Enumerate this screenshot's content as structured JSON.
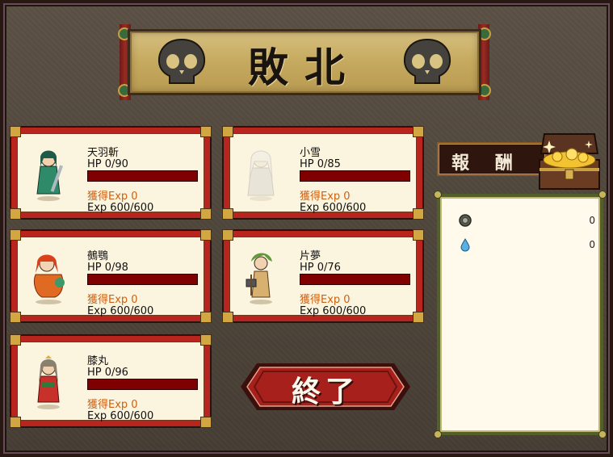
{
  "title": "敗北",
  "units": [
    {
      "name": "天羽斬",
      "hp": "HP 0/90",
      "hp_fraction": 0,
      "exp_gain": "獲得Exp 0",
      "exp": "Exp 600/600",
      "portrait": "green-armored-swordsman",
      "faded": false
    },
    {
      "name": "小雪",
      "hp": "HP 0/85",
      "hp_fraction": 0,
      "exp_gain": "獲得Exp 0",
      "exp": "Exp 600/600",
      "portrait": "white-haired-girl",
      "faded": true
    },
    {
      "name": "鵺鶚",
      "hp": "HP 0/98",
      "hp_fraction": 0,
      "exp_gain": "獲得Exp 0",
      "exp": "Exp 600/600",
      "portrait": "red-feathered-girl",
      "faded": false
    },
    {
      "name": "片夢",
      "hp": "HP 0/76",
      "hp_fraction": 0,
      "exp_gain": "獲得Exp 0",
      "exp": "Exp 600/600",
      "portrait": "green-haired-axe-girl",
      "faded": false
    },
    {
      "name": "膝丸",
      "hp": "HP 0/96",
      "hp_fraction": 0,
      "exp_gain": "獲得Exp 0",
      "exp": "Exp 600/600",
      "portrait": "kimono-swordswoman",
      "faded": false
    }
  ],
  "reward": {
    "label": "報 酬",
    "items": [
      {
        "icon": "coin-icon",
        "value": "0"
      },
      {
        "icon": "water-drop-icon",
        "value": "0"
      }
    ]
  },
  "end_button": {
    "label": "終了"
  },
  "colors": {
    "card_frame": "#b8251f",
    "card_bg": "#fbf4de",
    "hp_bar_empty": "#7e0000",
    "exp_gain": "#d06010",
    "button": "#a8201c"
  }
}
